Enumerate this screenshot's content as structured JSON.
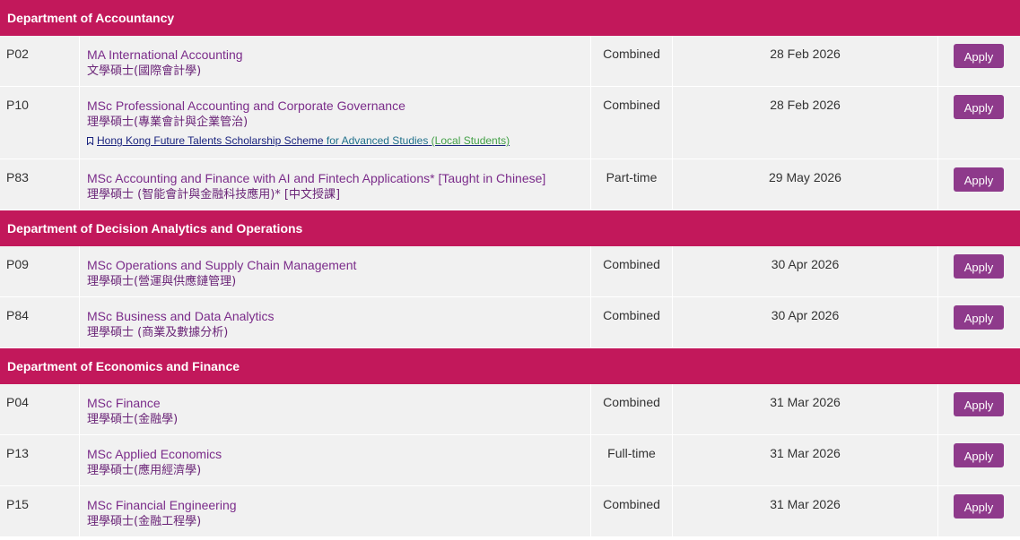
{
  "accent_color": "#c2185b",
  "button_color": "#8e3a8b",
  "apply_label": "Apply",
  "departments": [
    {
      "name": "Department of Accountancy",
      "programmes": [
        {
          "code": "P02",
          "title_en": "MA International Accounting",
          "title_zh": "文學碩士(國際會計學)",
          "mode": "Combined",
          "deadline": "28 Feb 2026"
        },
        {
          "code": "P10",
          "title_en": "MSc Professional Accounting and Corporate Governance",
          "title_zh": "理學碩士(專業會計與企業管治)",
          "mode": "Combined",
          "deadline": "28 Feb 2026",
          "scholarship": {
            "icon": "bookmark-icon",
            "part1": "Hong Kong Future Talents Scholarship Scheme",
            "part2": " for Advanced Studies",
            "part3": " (Local Students)"
          }
        },
        {
          "code": "P83",
          "title_en": "MSc Accounting and Finance with AI and Fintech Applications* [Taught in Chinese]",
          "title_zh": "理學碩士 (智能會計與金融科技應用)* [中文授課]",
          "mode": "Part-time",
          "deadline": "29 May 2026"
        }
      ]
    },
    {
      "name": "Department of Decision Analytics and Operations",
      "programmes": [
        {
          "code": "P09",
          "title_en": "MSc Operations and Supply Chain Management",
          "title_zh": "理學碩士(營運與供應鏈管理)",
          "mode": "Combined",
          "deadline": "30 Apr 2026"
        },
        {
          "code": "P84",
          "title_en": "MSc Business and Data Analytics",
          "title_zh": "理學碩士 (商業及數據分析)",
          "mode": "Combined",
          "deadline": "30 Apr 2026"
        }
      ]
    },
    {
      "name": "Department of Economics and Finance",
      "programmes": [
        {
          "code": "P04",
          "title_en": "MSc Finance",
          "title_zh": "理學碩士(金融學)",
          "mode": "Combined",
          "deadline": "31 Mar 2026"
        },
        {
          "code": "P13",
          "title_en": "MSc Applied Economics",
          "title_zh": "理學碩士(應用經濟學)",
          "mode": "Full-time",
          "deadline": "31 Mar 2026"
        },
        {
          "code": "P15",
          "title_en": "MSc Financial Engineering",
          "title_zh": "理學碩士(金融工程學)",
          "mode": "Combined",
          "deadline": "31 Mar 2026"
        }
      ]
    }
  ]
}
